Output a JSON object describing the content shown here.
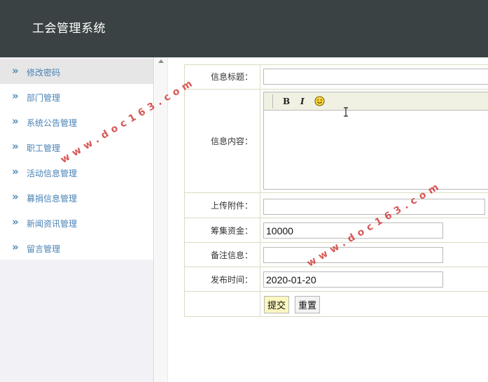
{
  "app": {
    "title": "工会管理系统"
  },
  "sidebar": {
    "items": [
      {
        "label": "修改密码",
        "chevron": "»"
      },
      {
        "label": "部门管理",
        "chevron": "»"
      },
      {
        "label": "系统公告管理",
        "chevron": "»"
      },
      {
        "label": "职工管理",
        "chevron": "»"
      },
      {
        "label": "活动信息管理",
        "chevron": "»"
      },
      {
        "label": "募捐信息管理",
        "chevron": "»"
      },
      {
        "label": "新闻资讯管理",
        "chevron": "»"
      },
      {
        "label": "留言管理",
        "chevron": "»"
      }
    ]
  },
  "form": {
    "info_title_label": "信息标题：",
    "info_title_value": "",
    "info_content_label": "信息内容：",
    "editor_toolbar": {
      "bold": "B",
      "italic": "I",
      "emoji_icon": "smiley-icon"
    },
    "attachment_label": "上传附件：",
    "attachment_value": "",
    "fund_label": "筹集资金：",
    "fund_value": "10000",
    "remark_label": "备注信息：",
    "remark_value": "",
    "publish_time_label": "发布时间：",
    "publish_time_value": "2020-01-20",
    "submit_label": "提交",
    "reset_label": "重置"
  },
  "watermarks": [
    "www.doc163.com",
    "www.doc163.com"
  ],
  "colors": {
    "header_bg": "#3a4244",
    "sidebar_link": "#4a82b5",
    "submit_bg": "#fbf7bf",
    "watermark": "#d33a3a"
  }
}
